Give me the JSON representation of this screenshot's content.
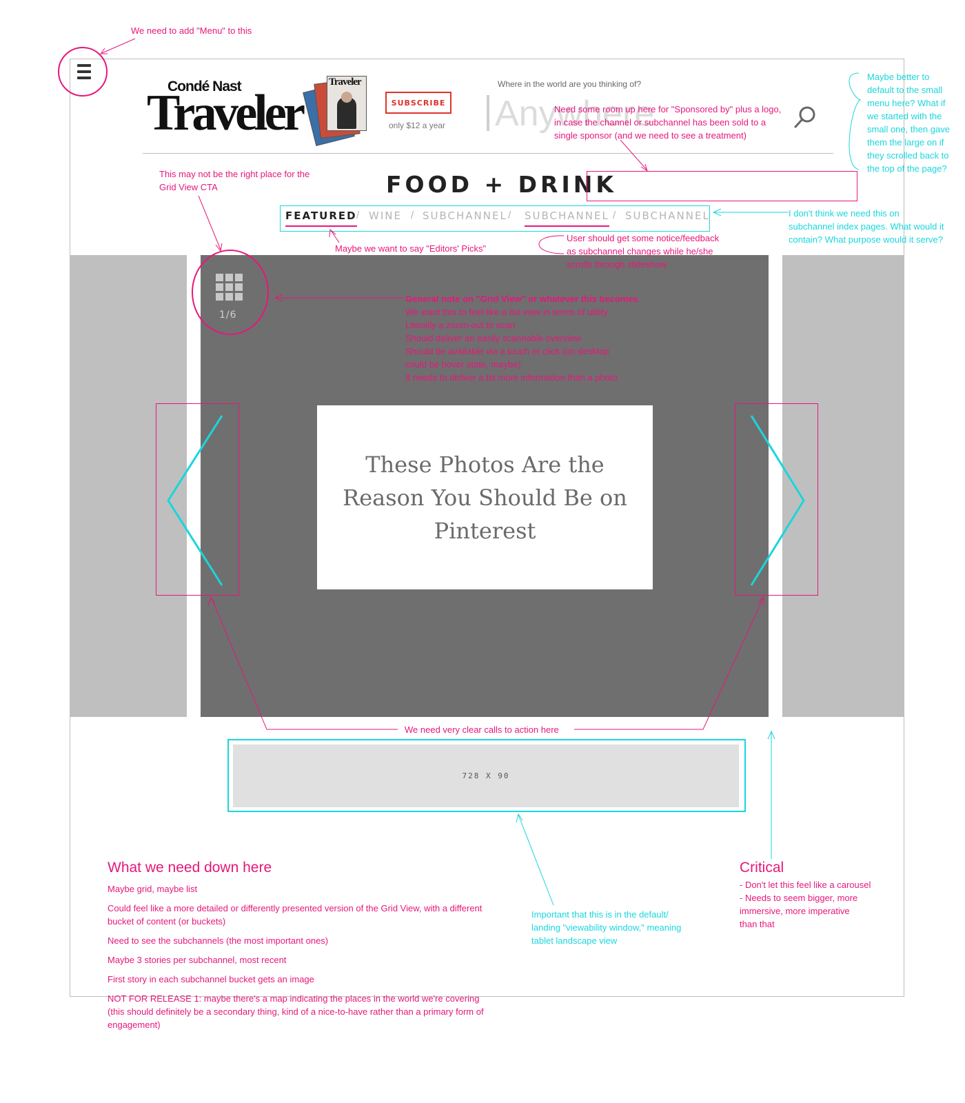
{
  "colors": {
    "annotation_pink": "#e6177a",
    "annotation_cyan": "#1ad6dc",
    "subscribe_red": "#e0322b",
    "slide_gray": "#6f6f6f",
    "side_gray": "#bfbfbf"
  },
  "header": {
    "logo_top": "Condé Nast",
    "logo_main": "Traveler",
    "magazine_cover_title": "Traveler",
    "subscribe_label": "SUBSCRIBE",
    "subscribe_price": "only $12 a year",
    "search_label": "Where in the world are you thinking of?",
    "search_placeholder": "Anywhere",
    "menu_icon": "hamburger-icon",
    "search_icon": "search-icon"
  },
  "channel": {
    "title": "FOOD + DRINK",
    "subnav": [
      {
        "label": "FEATURED"
      },
      {
        "label": "WINE"
      },
      {
        "label": "SUBCHANNEL"
      },
      {
        "label": "SUBCHANNEL"
      },
      {
        "label": "SUBCHANNEL"
      }
    ],
    "separator": "/"
  },
  "slideshow": {
    "grid_icon": "grid-icon",
    "counter": "1/6",
    "caption": "These Photos Are the Reason You Should Be on Pinterest",
    "prev_icon": "chevron-left-icon",
    "next_icon": "chevron-right-icon"
  },
  "ad": {
    "label": "728 X 90"
  },
  "annotations": {
    "menu": "We need to add \"Menu\" to this",
    "sponsor": [
      "Need some room up here for \"Sponsored by\" plus a logo,",
      "in case the channel or subchannel has been sold to a",
      "single sponsor (and we need to see a treatment)"
    ],
    "small_menu": [
      "Maybe better to",
      "default to the small",
      "menu here? What if",
      "we started with the",
      "small one, then gave",
      "them the large on if",
      "they scrolled back to",
      "the top of the page?"
    ],
    "grid_cta_place": [
      "This may not be the right place for the",
      "Grid View CTA"
    ],
    "subnav_purpose": [
      "I don't think we need this on",
      "subchannel index pages. What would it",
      "contain? What purpose would it serve?"
    ],
    "editors_picks": "Maybe we want to say \"Editors' Picks\"",
    "subchannel_feedback": [
      "User should get some notice/feedback",
      "as subchannel changes while he/she",
      "scrolls through slideshow"
    ],
    "grid_view_note": {
      "title": "General note on \"Grid View\" or whatever this becomes",
      "lines": [
        "We want this to feel like a list view in terms of utility",
        "Literally a zoom-out to scan",
        "Should deliver an easily scannable overview",
        "Should be available via a touch or click (on desktop",
        "could be hover state, maybe)",
        "It needs to deliver a bit more information than a photo"
      ]
    },
    "calls_to_action": "We need very clear calls to action here",
    "down_here": {
      "title": "What we need down here",
      "items": [
        "Maybe grid, maybe list",
        "Could feel like a more detailed or differently presented version of the Grid View, with a different bucket of content (or buckets)",
        "Need to see the subchannels (the most important ones)",
        "Maybe 3 stories per subchannel, most recent",
        "First story in each subchannel bucket gets an image",
        "NOT FOR RELEASE 1: maybe there's a map indicating the places in the world we're covering (this should definitely be a secondary thing, kind of a nice-to-have rather than a primary form of engagement)"
      ]
    },
    "viewability": [
      "Important that this is in the default/",
      "landing \"viewability window,\" meaning",
      "tablet landscape view"
    ],
    "critical": {
      "title": "Critical",
      "lines": [
        "- Don't let this feel like a carousel",
        "- Needs to seem bigger, more",
        "immersive, more imperative",
        "than that"
      ]
    }
  }
}
